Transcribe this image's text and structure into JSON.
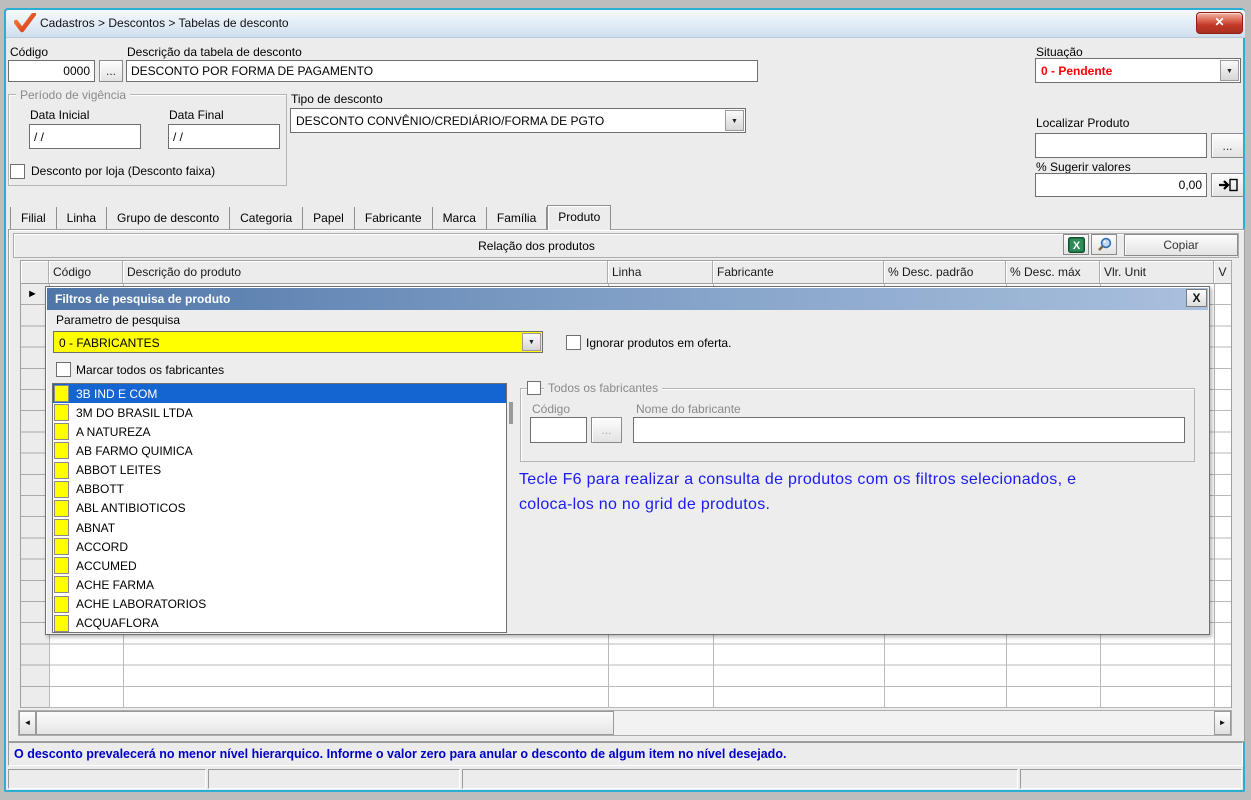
{
  "window": {
    "title": "Cadastros > Descontos > Tabelas de desconto"
  },
  "icons": {
    "logo": "orange-checkmark",
    "close": "✕",
    "modal_close": "X",
    "combo_arrow": "▼",
    "scroll_left": "◄",
    "scroll_right": "►",
    "row_marker": "►",
    "excel": "excel-export",
    "magnifier": "search-view",
    "apply": "arrow-into-document"
  },
  "header_form": {
    "codigo_label": "Código",
    "codigo_value": "0000",
    "browse_label": "...",
    "descricao_label": "Descrição da tabela de desconto",
    "descricao_value": "DESCONTO POR FORMA DE PAGAMENTO",
    "situacao_label": "Situação",
    "situacao_value": "0 - Pendente",
    "periodo_legend": "Período de vigência",
    "data_inicial_label": "Data Inicial",
    "data_inicial_value": "/ /",
    "data_final_label": "Data Final",
    "data_final_value": "/ /",
    "tipo_label": "Tipo de desconto",
    "tipo_value": "DESCONTO CONVÊNIO/CREDIÁRIO/FORMA DE PGTO",
    "localizar_label": "Localizar Produto",
    "localizar_value": "",
    "sugerir_label": "% Sugerir valores",
    "sugerir_value": "0,00",
    "loja_checkbox_label": "Desconto por loja (Desconto faixa)"
  },
  "tabs": {
    "items": [
      "Filial",
      "Linha",
      "Grupo de desconto",
      "Categoria",
      "Papel",
      "Fabricante",
      "Marca",
      "Família",
      "Produto"
    ],
    "active": "Produto"
  },
  "products_panel": {
    "caption": "Relação dos produtos",
    "copiar_label": "Copiar",
    "columns": [
      "Código",
      "Descrição do produto",
      "Linha",
      "Fabricante",
      "% Desc. padrão",
      "% Desc. máx",
      "Vlr. Unit",
      "V"
    ]
  },
  "filter_dialog": {
    "title": "Filtros de pesquisa de produto",
    "param_label": "Parametro de pesquisa",
    "param_value": "0 - FABRICANTES",
    "ignorar_label": "Ignorar produtos em oferta.",
    "marcar_todos_label": "Marcar todos os fabricantes",
    "fabricantes": [
      "3B IND E COM",
      "3M DO BRASIL LTDA",
      "A NATUREZA",
      "AB FARMO QUIMICA",
      "ABBOT LEITES",
      "ABBOTT",
      "ABL ANTIBIOTICOS",
      "ABNAT",
      "ACCORD",
      "ACCUMED",
      "ACHE FARMA",
      "ACHE LABORATORIOS",
      "ACQUAFLORA"
    ],
    "selected_index": 0,
    "todos_group": {
      "legend": "Todos os fabricantes",
      "codigo_label": "Código",
      "codigo_value": "",
      "browse_label": "...",
      "nome_label": "Nome do fabricante",
      "nome_value": ""
    },
    "hint": "Tecle F6 para realizar a consulta de produtos com os filtros selecionados, e coloca-los no no grid de produtos."
  },
  "footer": {
    "status_text": "O desconto prevalecerá no menor nível hierarquico. Informe o valor zero para anular o desconto de algum item no nível desejado."
  },
  "colors": {
    "window_border_teal": "#2aaed2",
    "situacao_red": "#ff0000",
    "selection_blue": "#1464d2",
    "hint_blue": "#1b1bee",
    "status_blue": "#0000c8",
    "highlight_yellow": "#ffff00",
    "modal_title_blue": "#4f76a8"
  }
}
